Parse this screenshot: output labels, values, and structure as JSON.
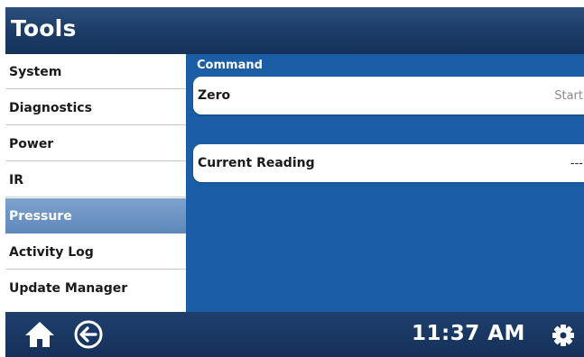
{
  "header": {
    "title": "Tools"
  },
  "sidebar": {
    "items": [
      {
        "label": "System"
      },
      {
        "label": "Diagnostics"
      },
      {
        "label": "Power"
      },
      {
        "label": "IR"
      },
      {
        "label": "Pressure",
        "selected": true
      },
      {
        "label": "Activity Log"
      },
      {
        "label": "Update Manager"
      }
    ]
  },
  "main": {
    "section_label": "Command",
    "rows": [
      {
        "label": "Zero",
        "value": "Start"
      },
      {
        "label": "Current Reading",
        "value": "---"
      }
    ]
  },
  "footer": {
    "time": "11:37 AM",
    "icons": [
      "home-icon",
      "back-arrow-icon",
      "gear-icon"
    ]
  },
  "colors": {
    "header_bg": "#1b3b66",
    "content_bg": "#1b5ea6",
    "selected_item": "#6a90c2",
    "footer_bg": "#15305a"
  }
}
